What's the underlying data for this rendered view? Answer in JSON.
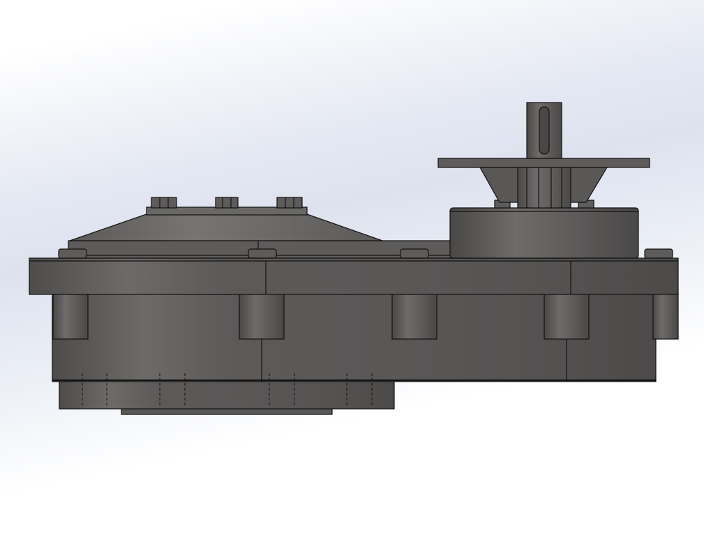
{
  "viewport": {
    "background_top": "#ffffff",
    "background_mid": "#dde2ee",
    "background_bottom": "#ffffff"
  },
  "model": {
    "view": "front",
    "body_color": "#5a5857",
    "body_highlight": "#7a7876",
    "edge_color": "#111111",
    "bolt_count_top": 3,
    "flange_bolt_count": 5,
    "boss_count": 5
  }
}
